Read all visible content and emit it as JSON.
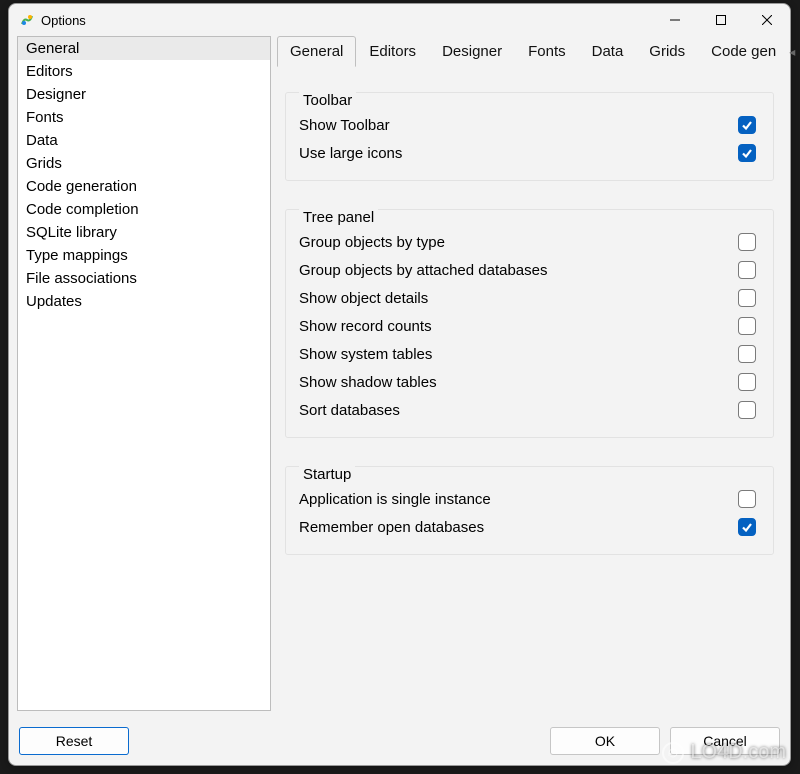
{
  "window": {
    "title": "Options"
  },
  "sidebar": {
    "items": [
      {
        "label": "General",
        "active": true
      },
      {
        "label": "Editors"
      },
      {
        "label": "Designer"
      },
      {
        "label": "Fonts"
      },
      {
        "label": "Data"
      },
      {
        "label": "Grids"
      },
      {
        "label": "Code generation"
      },
      {
        "label": "Code completion"
      },
      {
        "label": "SQLite library"
      },
      {
        "label": "Type mappings"
      },
      {
        "label": "File associations"
      },
      {
        "label": "Updates"
      }
    ]
  },
  "tabs": [
    {
      "label": "General",
      "active": true
    },
    {
      "label": "Editors"
    },
    {
      "label": "Designer"
    },
    {
      "label": "Fonts"
    },
    {
      "label": "Data"
    },
    {
      "label": "Grids"
    },
    {
      "label": "Code gen"
    }
  ],
  "groups": {
    "toolbar": {
      "legend": "Toolbar",
      "items": [
        {
          "label": "Show Toolbar",
          "checked": true
        },
        {
          "label": "Use large icons",
          "checked": true
        }
      ]
    },
    "treepanel": {
      "legend": "Tree panel",
      "items": [
        {
          "label": "Group objects by type",
          "checked": false
        },
        {
          "label": "Group objects by attached databases",
          "checked": false
        },
        {
          "label": "Show object details",
          "checked": false
        },
        {
          "label": "Show record counts",
          "checked": false
        },
        {
          "label": "Show system tables",
          "checked": false
        },
        {
          "label": "Show shadow tables",
          "checked": false
        },
        {
          "label": "Sort databases",
          "checked": false
        }
      ]
    },
    "startup": {
      "legend": "Startup",
      "items": [
        {
          "label": "Application is single instance",
          "checked": false
        },
        {
          "label": "Remember open databases",
          "checked": true
        }
      ]
    }
  },
  "footer": {
    "reset": "Reset",
    "ok": "OK",
    "cancel": "Cancel"
  },
  "watermark": "LO4D.com"
}
